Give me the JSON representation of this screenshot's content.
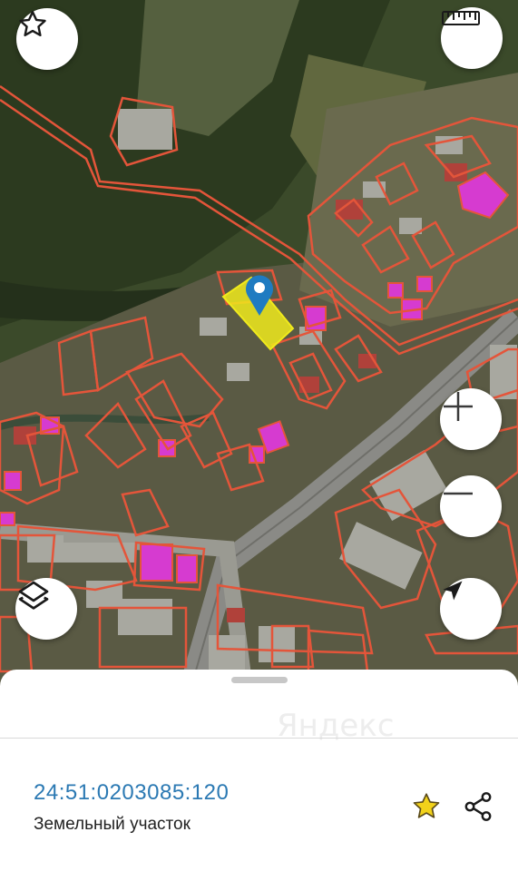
{
  "map": {
    "buttons": {
      "favorite": "star-icon",
      "ruler": "ruler-icon",
      "layers": "layers-icon",
      "zoom_in": "plus-icon",
      "zoom_out": "minus-icon",
      "locate": "location-arrow-icon"
    },
    "colors": {
      "parcel_outline": "#e4553a",
      "parcel_selected_fill": "#f0ea1c",
      "building_fill": "#d63bd0",
      "marker": "#1f7bc1"
    }
  },
  "sheet": {
    "watermark": "Яндекс",
    "cadastral_number": "24:51:0203085:120",
    "object_type": "Земельный участок",
    "icons": {
      "favorite": "star-icon",
      "share": "share-icon"
    },
    "colors": {
      "cadastral_number": "#2b79b3",
      "star": "#f2d21a"
    }
  }
}
